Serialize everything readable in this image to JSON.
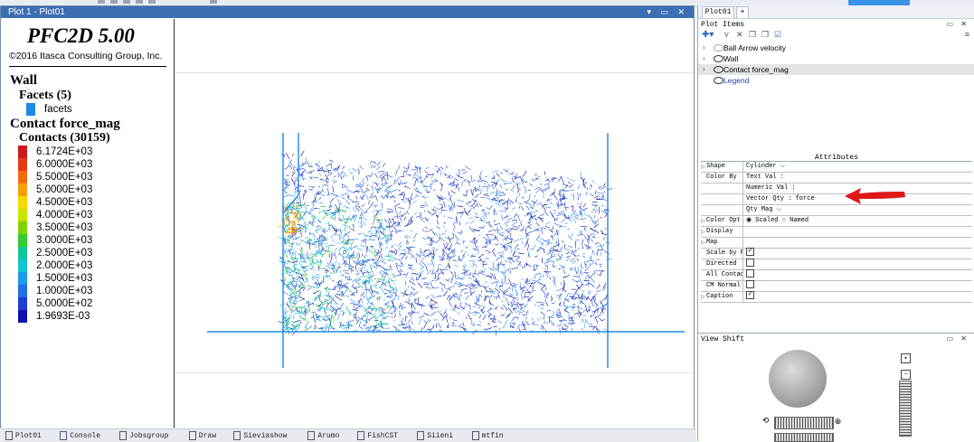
{
  "colors": {
    "title_bar": "#3d6fb4",
    "facet": "#1e88e5"
  },
  "plot_window": {
    "title": "Plot 1 - Plot01",
    "controls": "▾ ▭ ✕"
  },
  "legend": {
    "title": "PFC2D 5.00",
    "copyright": "©2016 Itasca Consulting Group, Inc.",
    "wall": "Wall",
    "facets_heading": "Facets (5)",
    "facets_item": "facets",
    "contact_heading": "Contact force_mag",
    "contacts_heading": "Contacts (30159)",
    "scale": [
      {
        "label": "6.1724E+03",
        "color": "#cc1a1a"
      },
      {
        "label": "6.0000E+03",
        "color": "#e23b12"
      },
      {
        "label": "5.5000E+03",
        "color": "#f26a0e"
      },
      {
        "label": "5.0000E+03",
        "color": "#f5a00a"
      },
      {
        "label": "4.5000E+03",
        "color": "#f7d800"
      },
      {
        "label": "4.0000E+03",
        "color": "#c9e400"
      },
      {
        "label": "3.5000E+03",
        "color": "#7fd400"
      },
      {
        "label": "3.0000E+03",
        "color": "#33cc33"
      },
      {
        "label": "2.5000E+03",
        "color": "#11c79a"
      },
      {
        "label": "2.0000E+03",
        "color": "#12c4d2"
      },
      {
        "label": "1.5000E+03",
        "color": "#1a9de8"
      },
      {
        "label": "1.0000E+03",
        "color": "#1f6fe0"
      },
      {
        "label": "5.0000E+02",
        "color": "#1c3ed0"
      },
      {
        "label": "1.9693E-03",
        "color": "#1010b0"
      }
    ]
  },
  "right": {
    "tabs": [
      "Plot01",
      "+"
    ],
    "plot_items_title": "Plot Items",
    "tree": [
      {
        "label": "Ball Arrow velocity",
        "selected": false
      },
      {
        "label": "Wall",
        "selected": false
      },
      {
        "label": "Contact force_mag",
        "selected": true
      },
      {
        "label": "Legend",
        "selected": false
      }
    ],
    "attributes_title": "Attributes",
    "attributes": [
      {
        "key": "Shape",
        "value": "Cylinder ⌵",
        "expand": "▷"
      },
      {
        "key": "Color By",
        "value": "Text Val    :",
        "expand": ""
      },
      {
        "key": "",
        "value": "Numeric Val :",
        "expand": ""
      },
      {
        "key": "",
        "value": "Vector Qty  :   force",
        "expand": ""
      },
      {
        "key": "",
        "value": "Qty         Mag  ⌵",
        "expand": ""
      },
      {
        "key": "Color Opt",
        "value": "◉ Scaled ○ Named",
        "expand": "▷"
      },
      {
        "key": "Display",
        "value": "",
        "expand": "▷"
      },
      {
        "key": "Map",
        "value": "",
        "expand": "▷"
      },
      {
        "key": "Scale by F",
        "value": "✓",
        "expand": ""
      },
      {
        "key": "Directed",
        "value": "",
        "expand": ""
      },
      {
        "key": "All Contac",
        "value": "",
        "expand": ""
      },
      {
        "key": "CM Normal",
        "value": "",
        "expand": ""
      },
      {
        "key": "Caption",
        "value": "✓",
        "expand": "▷"
      }
    ],
    "view_shift_title": "View Shift"
  },
  "taskbar": [
    "Plot01",
    "Console",
    "Jobsgroup",
    "Draw",
    "Sieviashow",
    "Arumo",
    "FishCST",
    "Siieni",
    "mtfin"
  ]
}
